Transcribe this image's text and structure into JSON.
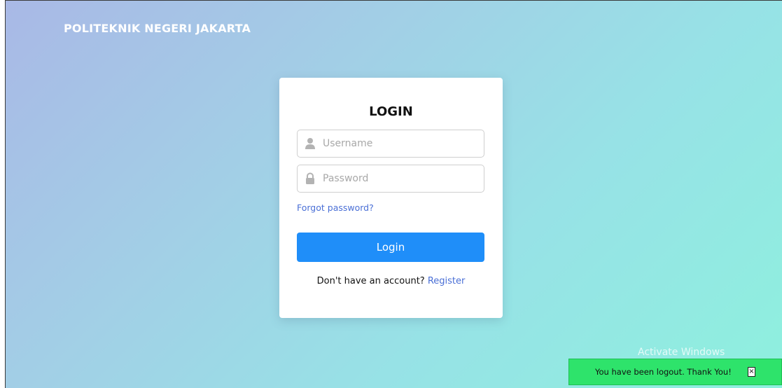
{
  "header": {
    "brand": "POLITEKNIK NEGERI JAKARTA"
  },
  "login_card": {
    "title": "LOGIN",
    "username": {
      "placeholder": "Username",
      "value": "",
      "icon": "user-icon"
    },
    "password": {
      "placeholder": "Password",
      "value": "",
      "icon": "lock-icon"
    },
    "forgot_label": "Forgot password?",
    "login_label": "Login",
    "register_prompt": "Don't have an account?",
    "register_label": "Register"
  },
  "toast": {
    "message": "You have been logout. Thank You!",
    "close_label": "×",
    "color": "#2ee36b"
  },
  "os_watermark": "Activate Windows",
  "colors": {
    "accent": "#1f8ef9",
    "link": "#4a6fd6",
    "gradient_start": "#a9b8e6",
    "gradient_end": "#8ef0de"
  }
}
